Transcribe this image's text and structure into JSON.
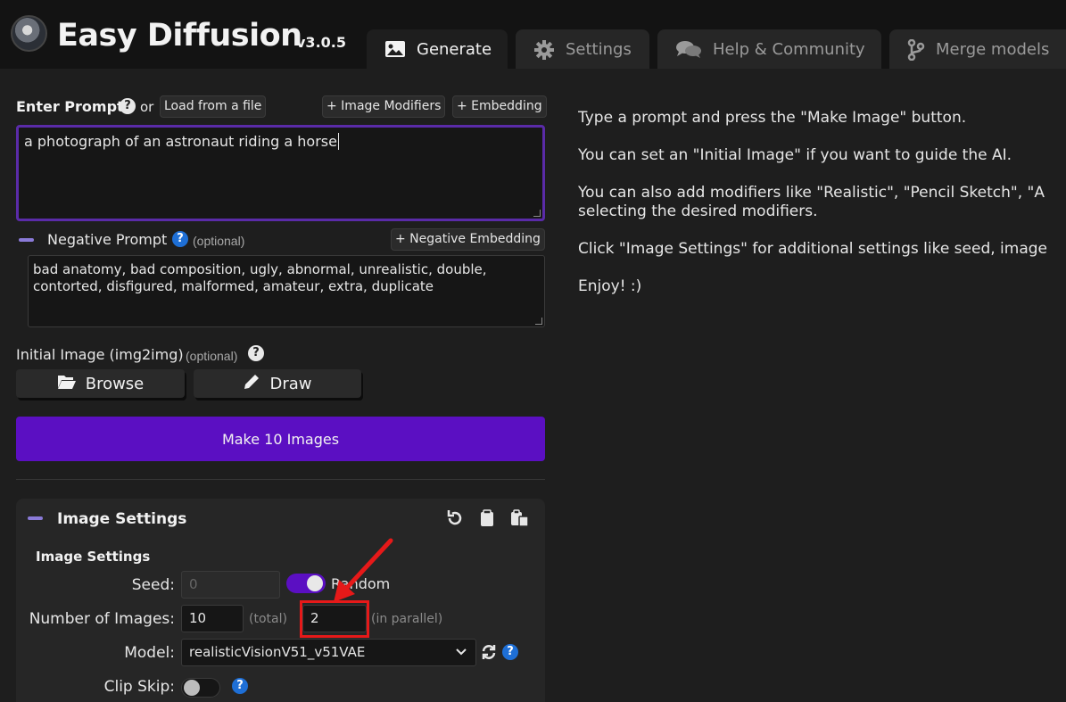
{
  "header": {
    "app_name": "Easy Diffusion",
    "version": "v3.0.5",
    "tabs": [
      {
        "label": "Generate",
        "icon": "image-icon",
        "active": true
      },
      {
        "label": "Settings",
        "icon": "gear-icon",
        "active": false
      },
      {
        "label": "Help & Community",
        "icon": "comments-icon",
        "active": false
      },
      {
        "label": "Merge models",
        "icon": "code-branch-icon",
        "active": false
      }
    ]
  },
  "prompt": {
    "label": "Enter Prompt",
    "or_text": "or",
    "load_file": "Load from a file",
    "image_modifiers": "+ Image Modifiers",
    "embedding": "+ Embedding",
    "value": "a photograph of an astronaut riding a horse"
  },
  "negative": {
    "label": "Negative Prompt",
    "optional": "(optional)",
    "embedding_button": "+ Negative Embedding",
    "value": "bad anatomy, bad composition, ugly, abnormal, unrealistic, double, contorted, disfigured, malformed, amateur, extra, duplicate"
  },
  "init_image": {
    "label": "Initial Image (img2img)",
    "optional": "(optional)",
    "browse": "Browse",
    "draw": "Draw"
  },
  "make_button": "Make 10 Images",
  "image_settings": {
    "panel_title": "Image Settings",
    "section_title": "Image Settings",
    "seed_label": "Seed:",
    "seed_placeholder": "0",
    "random_label": "Random",
    "num_images_label": "Number of Images:",
    "num_total": "10",
    "total_label": "(total)",
    "num_parallel": "2",
    "parallel_label": "(in parallel)",
    "model_label": "Model:",
    "model_value": "realisticVisionV51_v51VAE",
    "clip_skip_label": "Clip Skip:"
  },
  "help_text": [
    "Type a prompt and press the \"Make Image\" button.",
    "You can set an \"Initial Image\" if you want to guide the AI.",
    "You can also add modifiers like \"Realistic\", \"Pencil Sketch\", \"A",
    "selecting the desired modifiers.",
    "Click \"Image Settings\" for additional settings like seed, image",
    "Enjoy! :)"
  ],
  "colors": {
    "accent": "#5b0fc2",
    "prompt_border": "#5a2ba8",
    "annotation": "#e61919",
    "help_blue": "#1e6fd6"
  }
}
